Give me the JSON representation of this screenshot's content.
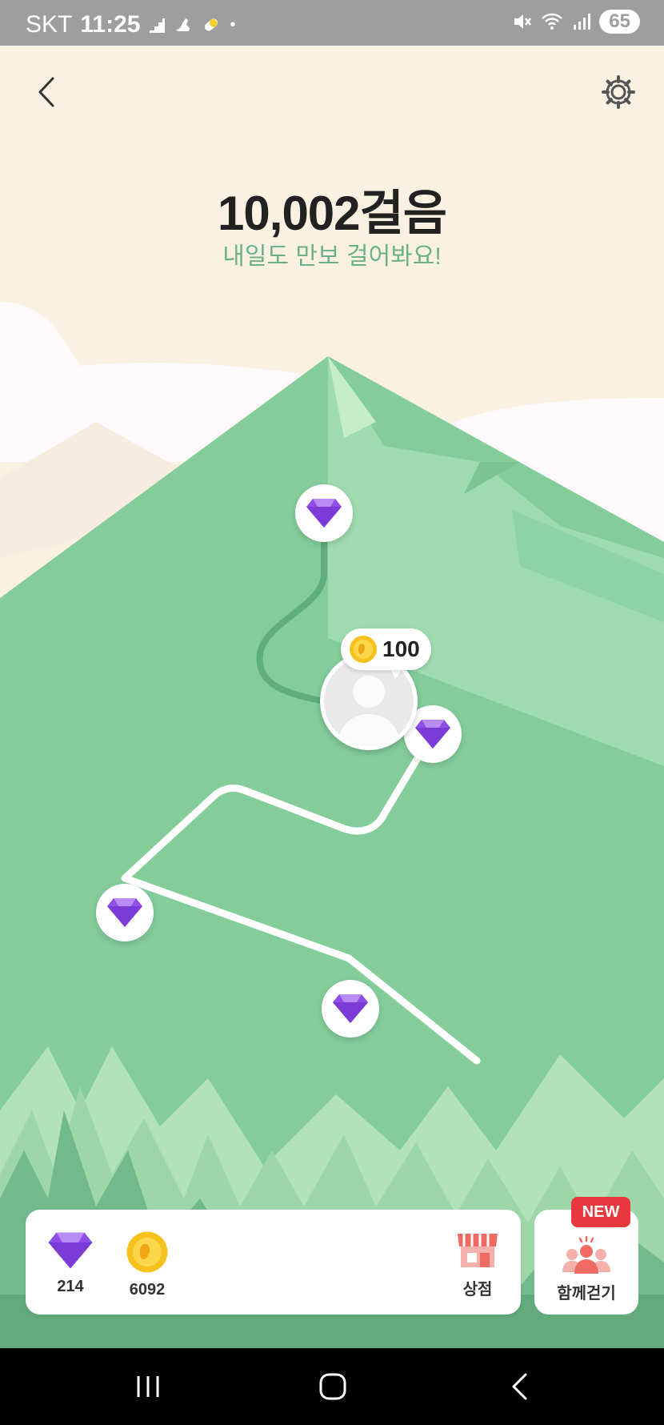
{
  "status_bar": {
    "carrier": "SKT",
    "time": "11:25",
    "battery": "65"
  },
  "header": {
    "back_icon": "chevron-left-icon",
    "settings_icon": "gear-icon"
  },
  "steps": {
    "count_text": "10,002걸음",
    "message": "내일도 만보 걸어봐요!"
  },
  "avatar": {
    "reward_amount": "100"
  },
  "wallet": {
    "gems": "214",
    "coins": "6092",
    "shop_label": "상점"
  },
  "together": {
    "label": "함께걷기",
    "badge": "NEW"
  },
  "colors": {
    "mountain": "#84cd9b",
    "path": "#ffffff",
    "gem": "#8f4ee6",
    "badge": "#e8383d",
    "shop": "#ef6a63"
  }
}
